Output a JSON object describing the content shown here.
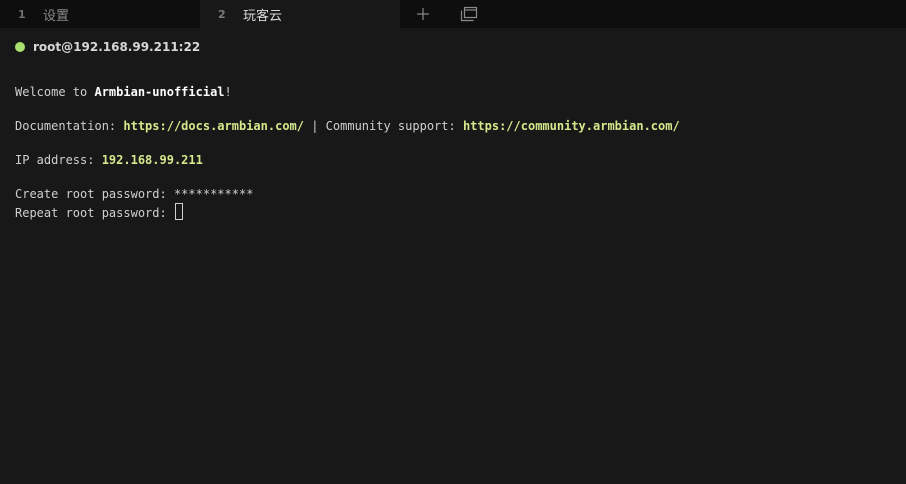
{
  "tabs": [
    {
      "index": "1",
      "title": "设置",
      "active": false
    },
    {
      "index": "2",
      "title": "玩客云",
      "active": true
    }
  ],
  "tab_actions": {
    "new_tab_icon": "plus-icon",
    "windows_icon": "windows-overview-icon"
  },
  "connection": {
    "status_color": "#a9e070",
    "label": "root@192.168.99.211:22"
  },
  "terminal": {
    "welcome_prefix": "Welcome to ",
    "welcome_name": "Armbian-unofficial",
    "welcome_suffix": "!",
    "doc_label": "Documentation: ",
    "doc_url": "https://docs.armbian.com/",
    "doc_sep": " | Community support: ",
    "community_url": "https://community.armbian.com/",
    "ip_label": "IP address: ",
    "ip_value": "192.168.99.211",
    "create_pw_prompt": "Create root password: ",
    "create_pw_value": "***********",
    "repeat_pw_prompt": "Repeat root password: "
  },
  "colors": {
    "background": "#181818",
    "tabbar": "#0e0e0e",
    "highlight": "#d3e98b"
  }
}
